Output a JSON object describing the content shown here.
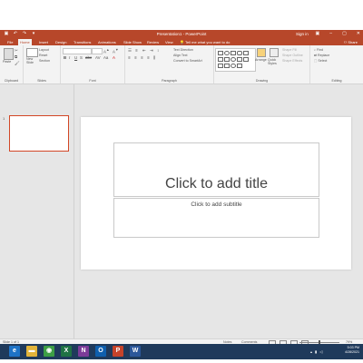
{
  "titlebar": {
    "document_title": "Presentation1 - PowerPoint",
    "sign_in": "Sign in",
    "save_icon": "save-icon",
    "undo_icon": "undo-icon",
    "redo_icon": "redo-icon",
    "minimize": "–",
    "restore": "▢",
    "close": "✕"
  },
  "tabs": [
    {
      "label": "File"
    },
    {
      "label": "Home"
    },
    {
      "label": "Insert"
    },
    {
      "label": "Design"
    },
    {
      "label": "Transitions"
    },
    {
      "label": "Animations"
    },
    {
      "label": "Slide Show"
    },
    {
      "label": "Review"
    },
    {
      "label": "View"
    }
  ],
  "active_tab": "Home",
  "tell_me": "Tell me what you want to do",
  "share": "Share",
  "ribbon": {
    "groups": {
      "clipboard": "Clipboard",
      "slides": "Slides",
      "font": "Font",
      "paragraph": "Paragraph",
      "drawing": "Drawing",
      "editing": "Editing"
    },
    "paste": "Paste",
    "new_slide": "New Slide",
    "layout": "Layout",
    "reset": "Reset",
    "section": "Section",
    "text_direction": "Text Direction",
    "align_text": "Align Text",
    "convert_smartart": "Convert to SmartArt",
    "arrange": "Arrange",
    "quick_styles": "Quick Styles",
    "shape_fill": "Shape Fill",
    "shape_outline": "Shape Outline",
    "shape_effects": "Shape Effects",
    "find": "Find",
    "replace": "Replace",
    "select": "Select"
  },
  "slides_pane": {
    "slide_number": "1"
  },
  "slide": {
    "title_placeholder": "Click to add title",
    "subtitle_placeholder": "Click to add subtitle"
  },
  "statusbar": {
    "slide_info": "Slide 1 of 1",
    "notes": "Notes",
    "comments": "Comments",
    "zoom": "79%"
  },
  "taskbar": {
    "apps": [
      {
        "name": "ie",
        "glyph": "e",
        "color": "#1e73c6"
      },
      {
        "name": "file-explorer",
        "glyph": "▬",
        "color": "#e2b43a"
      },
      {
        "name": "chrome",
        "glyph": "◉",
        "color": "#3d9e45"
      },
      {
        "name": "excel",
        "glyph": "X",
        "color": "#1f7244"
      },
      {
        "name": "onenote",
        "glyph": "N",
        "color": "#7b3b98"
      },
      {
        "name": "outlook",
        "glyph": "O",
        "color": "#0f5fad"
      },
      {
        "name": "powerpoint",
        "glyph": "P",
        "color": "#c5432a"
      },
      {
        "name": "word",
        "glyph": "W",
        "color": "#2b579a"
      }
    ],
    "time": "5:03 PM",
    "date": "4/28/2021"
  }
}
